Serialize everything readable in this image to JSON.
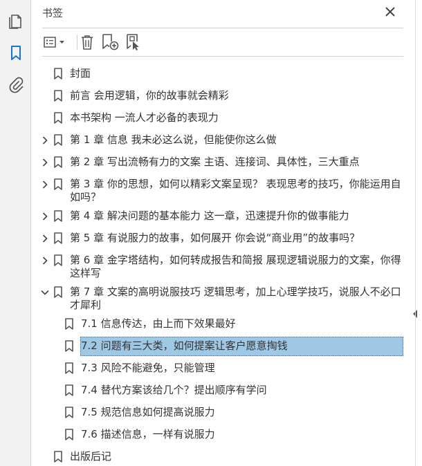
{
  "panel": {
    "title": "书签"
  },
  "rail": {
    "items": [
      {
        "name": "pages-icon"
      },
      {
        "name": "bookmarks-icon",
        "active": true
      },
      {
        "name": "attachments-icon"
      }
    ]
  },
  "toolbar": {
    "buttons": [
      "options-menu-icon",
      "delete-bookmark-icon",
      "new-bookmark-icon",
      "bookmark-from-selection-icon"
    ]
  },
  "bookmarks": [
    {
      "label": "封面",
      "expandable": false,
      "level": 0
    },
    {
      "label": "前言 会用逻辑，你的故事就会精彩",
      "expandable": false,
      "level": 0
    },
    {
      "label": "本书架构 一流人才必备的表现力",
      "expandable": false,
      "level": 0
    },
    {
      "label": "第 1 章 信息 我未必这么说，但能使你这么做",
      "expandable": true,
      "expanded": false,
      "level": 0
    },
    {
      "label": "第 2 章 写出流畅有力的文案 主语、连接词、具体性，三大重点",
      "expandable": true,
      "expanded": false,
      "level": 0
    },
    {
      "label": "第 3 章 你的思想，如何以精彩文案呈现？ 表现思考的技巧，你能运用自如吗？",
      "expandable": true,
      "expanded": false,
      "level": 0
    },
    {
      "label": "第 4 章 解决问题的基本能力 这一章，迅速提升你的做事能力",
      "expandable": true,
      "expanded": false,
      "level": 0
    },
    {
      "label": "第 5 章 有说服力的故事，如何展开 你会说“商业用”的故事吗？",
      "expandable": true,
      "expanded": false,
      "level": 0
    },
    {
      "label": "第 6 章 金字塔结构，如何转成报告和简报 展现逻辑说服力的文案，你得这样写",
      "expandable": true,
      "expanded": false,
      "level": 0
    },
    {
      "label": "第 7 章 文案的高明说服技巧 逻辑思考，加上心理学技巧，说服人不必口才犀利",
      "expandable": true,
      "expanded": true,
      "level": 0
    },
    {
      "label": "7.1 信息传达，由上而下效果最好",
      "expandable": false,
      "level": 1
    },
    {
      "label": "7.2 问题有三大类，如何提案让客户愿意掏钱",
      "expandable": false,
      "level": 1,
      "selected": true
    },
    {
      "label": "7.3 风险不能避免，只能管理",
      "expandable": false,
      "level": 1
    },
    {
      "label": "7.4 替代方案该给几个？提出顺序有学问",
      "expandable": false,
      "level": 1
    },
    {
      "label": "7.5 规范信息如何提高说服力",
      "expandable": false,
      "level": 1
    },
    {
      "label": "7.6 描述信息，一样有说服力",
      "expandable": false,
      "level": 1
    },
    {
      "label": "出版后记",
      "expandable": false,
      "level": 0
    }
  ],
  "colors": {
    "accent": "#1a73c8",
    "selection": "#9fc8e4",
    "icon": "#555555"
  }
}
